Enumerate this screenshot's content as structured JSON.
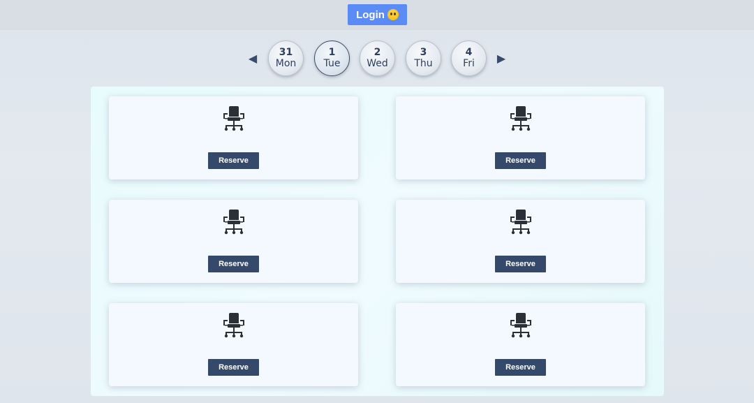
{
  "header": {
    "login_label": "Login",
    "login_emoji_icon": "pleading-face-icon"
  },
  "date_nav": {
    "prev_icon": "triangle-left-icon",
    "next_icon": "triangle-right-icon",
    "prev_glyph": "◀",
    "next_glyph": "▶",
    "days": [
      {
        "num": "31",
        "weekday": "Mon",
        "selected": false
      },
      {
        "num": "1",
        "weekday": "Tue",
        "selected": true
      },
      {
        "num": "2",
        "weekday": "Wed",
        "selected": false
      },
      {
        "num": "3",
        "weekday": "Thu",
        "selected": false
      },
      {
        "num": "4",
        "weekday": "Fri",
        "selected": false
      }
    ]
  },
  "seats": [
    {
      "icon": "office-chair-icon",
      "reserve_label": "Reserve"
    },
    {
      "icon": "office-chair-icon",
      "reserve_label": "Reserve"
    },
    {
      "icon": "office-chair-icon",
      "reserve_label": "Reserve"
    },
    {
      "icon": "office-chair-icon",
      "reserve_label": "Reserve"
    },
    {
      "icon": "office-chair-icon",
      "reserve_label": "Reserve"
    },
    {
      "icon": "office-chair-icon",
      "reserve_label": "Reserve"
    }
  ],
  "colors": {
    "login_button": "#5b8cf5",
    "reserve_button": "#354a6b",
    "day_text": "#2f3e5c",
    "panel_bg": "#ecfbfd"
  }
}
